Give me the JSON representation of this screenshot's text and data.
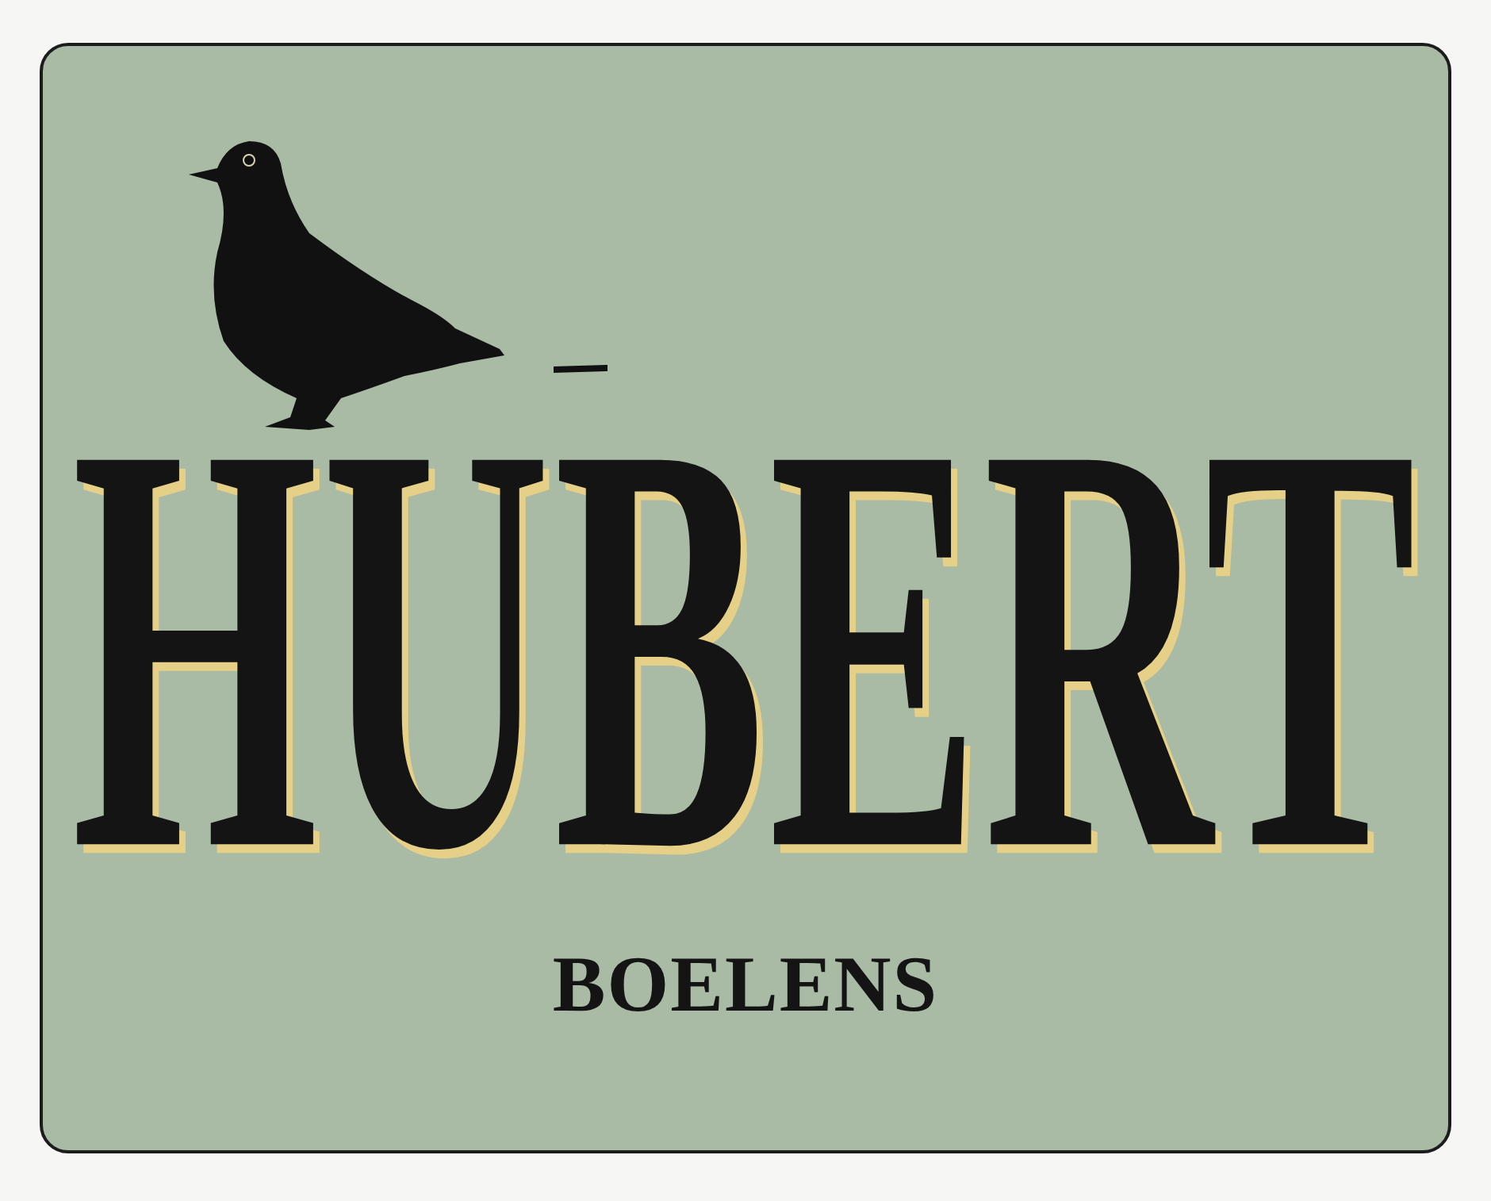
{
  "sign": {
    "title": "HUBERT",
    "subtitle": "BOELENS"
  }
}
